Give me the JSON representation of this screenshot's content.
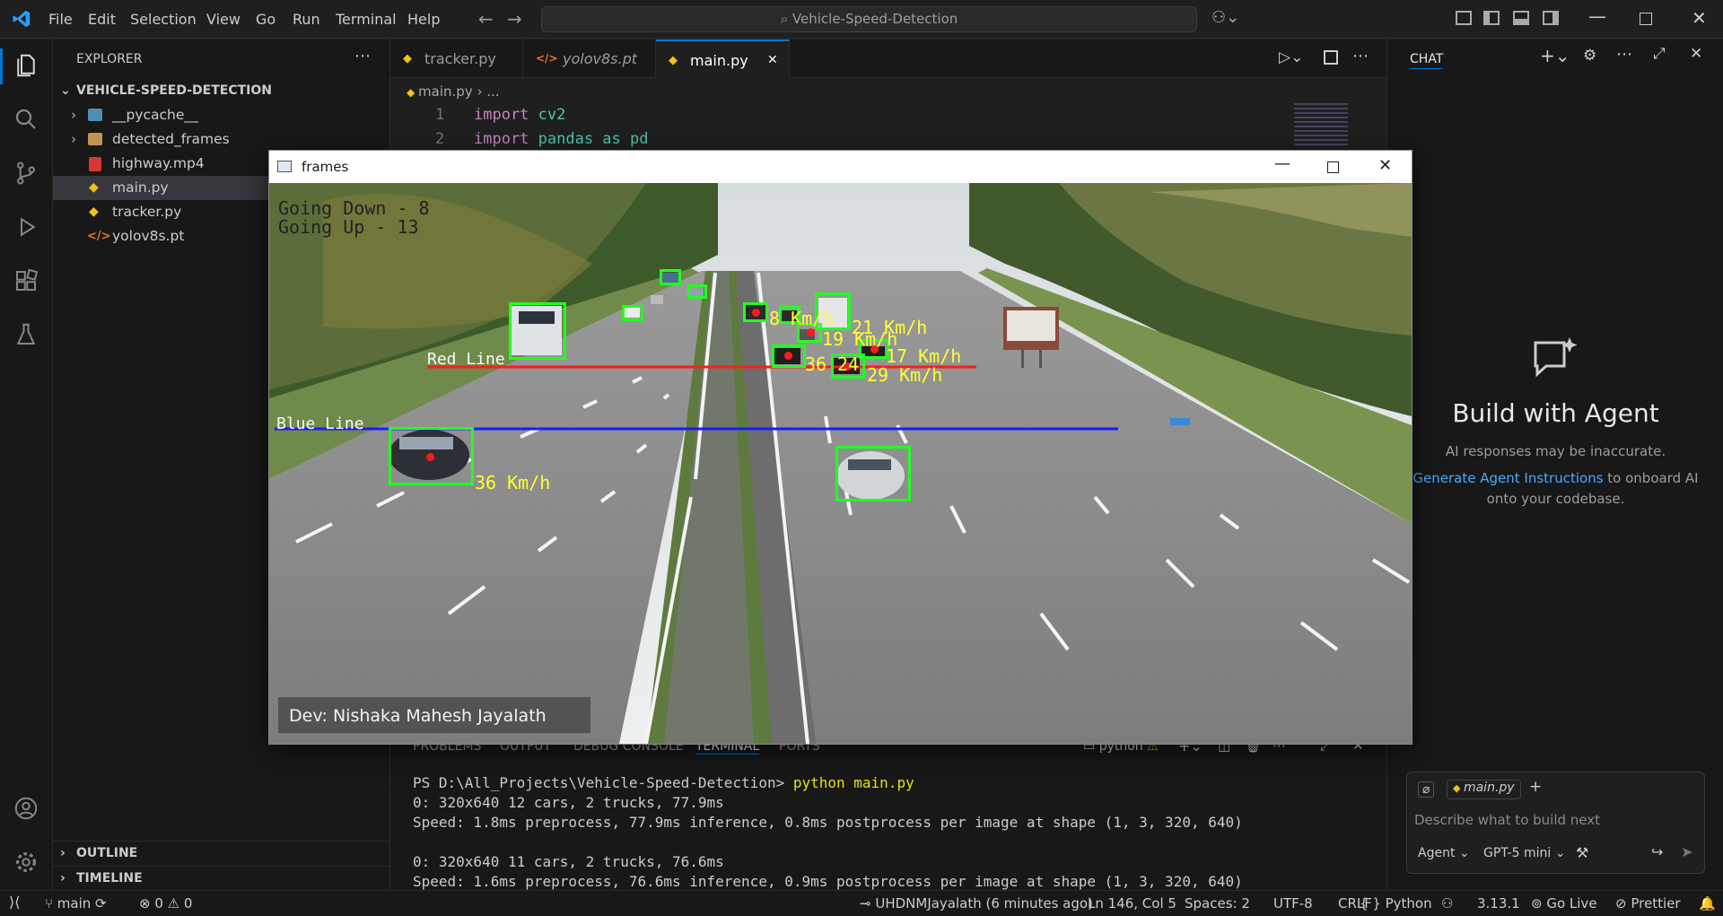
{
  "menu": [
    "File",
    "Edit",
    "Selection",
    "View",
    "Go",
    "Run",
    "Terminal",
    "Help"
  ],
  "search": {
    "text": "Vehicle-Speed-Detection"
  },
  "explorer": {
    "header": "EXPLORER",
    "root": "VEHICLE-SPEED-DETECTION",
    "items": [
      {
        "label": "__pycache__",
        "kind": "folder"
      },
      {
        "label": "detected_frames",
        "kind": "folder"
      },
      {
        "label": "highway.mp4",
        "kind": "video"
      },
      {
        "label": "main.py",
        "kind": "python"
      },
      {
        "label": "tracker.py",
        "kind": "python"
      },
      {
        "label": "yolov8s.pt",
        "kind": "code"
      }
    ],
    "outline": "OUTLINE",
    "timeline": "TIMELINE"
  },
  "tabs": [
    {
      "label": "tracker.py"
    },
    {
      "label": "yolov8s.pt"
    },
    {
      "label": "main.py",
      "close": "✕"
    }
  ],
  "breadcrumb": {
    "file": "main.py",
    "rest": "..."
  },
  "code": [
    {
      "num": "1",
      "kw": "import",
      "rest": " cv2"
    },
    {
      "num": "2",
      "kw": "import",
      "rest": " pandas as pd"
    }
  ],
  "frames_window": {
    "title": "frames",
    "counters": {
      "down": "Going Down - 8",
      "up": "Going Up - 13"
    },
    "red_line_label": "Red Line",
    "blue_line_label": "Blue Line",
    "speeds": [
      "36 Km/h",
      "21 Km/h",
      "19 Km/h",
      "17 Km/h",
      "29 Km/h",
      "8 Km/h",
      "36",
      "24"
    ],
    "dev_credit": "Dev: Nishaka Mahesh Jayalath"
  },
  "panel": {
    "tabs": [
      "PROBLEMS",
      "OUTPUT",
      "DEBUG CONSOLE",
      "TERMINAL",
      "PORTS"
    ],
    "shell_label": "python",
    "terminal_lines": [
      "PS D:\\All_Projects\\Vehicle-Speed-Detection> ",
      "0: 320x640 12 cars, 2 trucks, 77.9ms",
      "Speed: 1.8ms preprocess, 77.9ms inference, 0.8ms postprocess per image at shape (1, 3, 320, 640)",
      "",
      "0: 320x640 11 cars, 2 trucks, 76.6ms",
      "Speed: 1.6ms preprocess, 76.6ms inference, 0.9ms postprocess per image at shape (1, 3, 320, 640)"
    ],
    "command": "python main.py"
  },
  "chat": {
    "header": "CHAT",
    "title": "Build with Agent",
    "disclaimer": "AI responses may be inaccurate.",
    "link": "Generate Agent Instructions",
    "link_rest": " to onboard AI onto your codebase.",
    "context_file": "main.py",
    "placeholder": "Describe what to build next",
    "mode": "Agent",
    "model": "GPT-5 mini"
  },
  "status": {
    "branch": "main",
    "errors": "0",
    "warnings": "0",
    "blame": "UHDNMJayalath (6 minutes ago)",
    "position": "Ln 146, Col 5",
    "spaces": "Spaces: 2",
    "encoding": "UTF-8",
    "eol": "CRLF",
    "language": "Python",
    "python_version": "3.13.1",
    "golive": "Go Live",
    "prettier": "Prettier"
  },
  "colors": {
    "accent": "#0078d4",
    "link": "#4daafc",
    "detection": "#22ff22",
    "speed_text": "#ffff33"
  }
}
